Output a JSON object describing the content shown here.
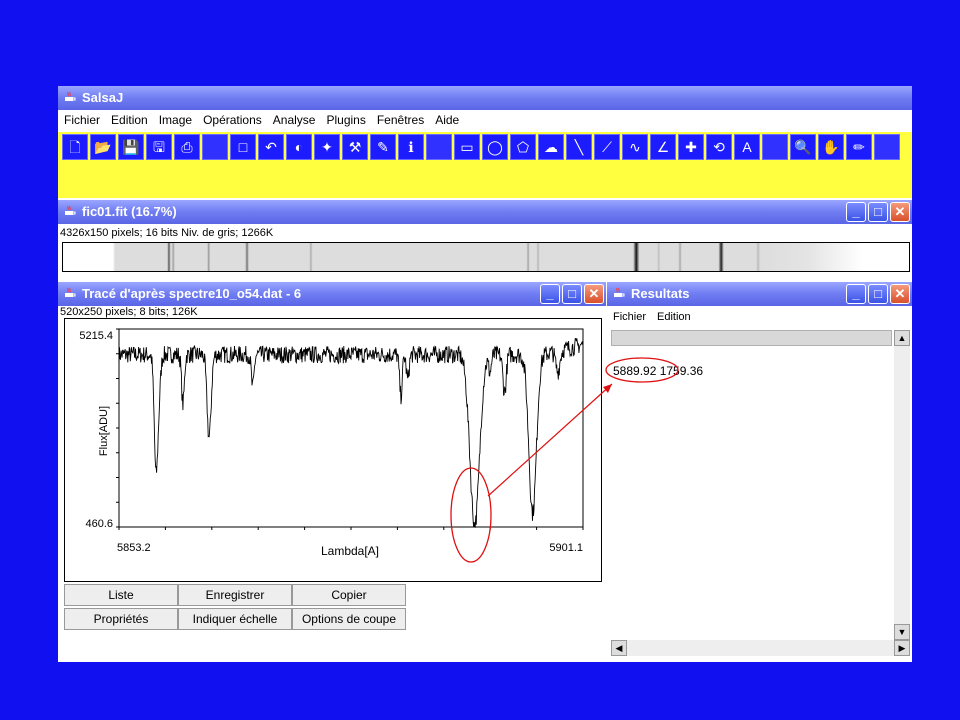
{
  "main_window": {
    "title": "SalsaJ",
    "menu": [
      "Fichier",
      "Edition",
      "Image",
      "Opérations",
      "Analyse",
      "Plugins",
      "Fenêtres",
      "Aide"
    ]
  },
  "toolbar_icons": [
    "new-file-icon",
    "open-folder-icon",
    "save-icon",
    "save-as-icon",
    "print-icon",
    "blank",
    "select-icon",
    "undo-icon",
    "contrast-icon",
    "magic-wand-icon",
    "tools-icon",
    "eraser-icon",
    "info-icon",
    "blank",
    "rectangle-icon",
    "oval-icon",
    "polygon-icon",
    "freehand-icon",
    "line-icon",
    "segmented-line-icon",
    "freehand-line-icon",
    "angle-icon",
    "crosshair-icon",
    "wand-icon",
    "text-icon",
    "blank",
    "magnifier-icon",
    "hand-icon",
    "pencil-icon",
    "blank"
  ],
  "image_window": {
    "title": "fic01.fit (16.7%)",
    "info": "4326x150 pixels; 16 bits Niv. de gris; 1266K"
  },
  "plot_window": {
    "title": "Tracé d'après spectre10_o54.dat - 6",
    "info": "520x250 pixels; 8 bits; 126K",
    "buttons_row1": [
      "Liste",
      "Enregistrer",
      "Copier"
    ],
    "buttons_row2": [
      "Propriétés",
      "Indiquer échelle",
      "Options de coupe"
    ]
  },
  "results_window": {
    "title": "Resultats",
    "menu": [
      "Fichier",
      "Edition"
    ],
    "value": "5889.92 1759.36"
  },
  "chart_data": {
    "type": "line",
    "xlabel": "Lambda[A]",
    "ylabel": "Flux[ADU]",
    "xlim": [
      5853.2,
      5901.1
    ],
    "ylim": [
      460.6,
      5215.4
    ],
    "x_tick_labels": [
      "5853.2",
      "5901.1"
    ],
    "y_tick_labels": [
      "5215.4",
      "460.6"
    ],
    "continuum": 4600,
    "absorption_lines": [
      {
        "x": 5857.0,
        "depth": 2600,
        "width": 0.25
      },
      {
        "x": 5857.3,
        "depth": 1000,
        "width": 0.25
      },
      {
        "x": 5859.8,
        "depth": 1200,
        "width": 0.2
      },
      {
        "x": 5862.5,
        "depth": 2000,
        "width": 0.3
      },
      {
        "x": 5867.0,
        "depth": 800,
        "width": 0.2
      },
      {
        "x": 5882.3,
        "depth": 1000,
        "width": 0.2
      },
      {
        "x": 5883.0,
        "depth": 600,
        "width": 0.2
      },
      {
        "x": 5889.92,
        "depth": 4100,
        "width": 0.7
      },
      {
        "x": 5891.5,
        "depth": 400,
        "width": 0.2
      },
      {
        "x": 5893.0,
        "depth": 900,
        "width": 0.25
      },
      {
        "x": 5895.9,
        "depth": 3800,
        "width": 0.55
      },
      {
        "x": 5898.5,
        "depth": 500,
        "width": 0.3
      }
    ]
  }
}
